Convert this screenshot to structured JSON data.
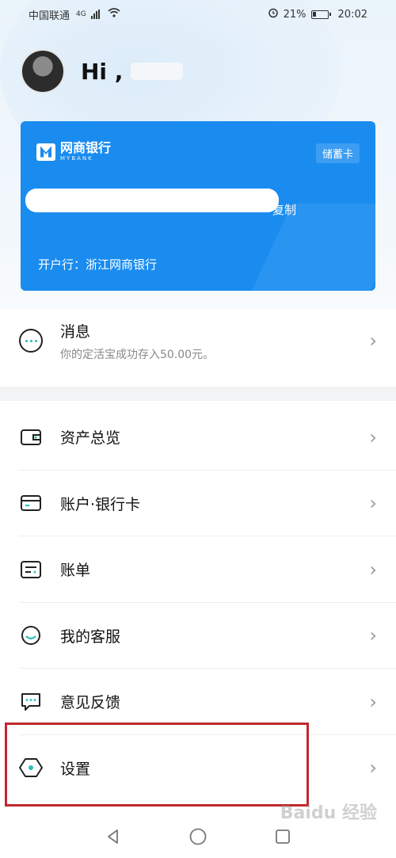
{
  "status_bar": {
    "carrier": "中国联通",
    "network": "4G",
    "battery": "21%",
    "time": "20:02"
  },
  "greeting": {
    "text": "Hi ,"
  },
  "card": {
    "logo_cn": "网商银行",
    "logo_en": "MYBANK",
    "type": "储蓄卡",
    "copy_label": "复制",
    "bank": "开户行：浙江网商银行"
  },
  "message": {
    "title": "消息",
    "subtitle": "你的定活宝成功存入50.00元。"
  },
  "menu": {
    "items": [
      {
        "label": "资产总览",
        "icon": "wallet-icon"
      },
      {
        "label": "账户·银行卡",
        "icon": "card-icon"
      },
      {
        "label": "账单",
        "icon": "bill-icon"
      },
      {
        "label": "我的客服",
        "icon": "customer-service-icon"
      },
      {
        "label": "意见反馈",
        "icon": "feedback-icon"
      },
      {
        "label": "设置",
        "icon": "settings-icon"
      }
    ]
  },
  "watermark": "Baidu 经验",
  "colors": {
    "card_blue": "#1a8cf0",
    "accent_teal": "#2abcb8",
    "highlight_red": "#c0282d"
  }
}
